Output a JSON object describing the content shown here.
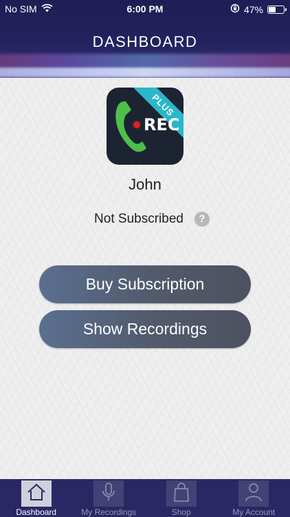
{
  "status_bar": {
    "carrier": "No SIM",
    "time": "6:00 PM",
    "battery": "47%",
    "battery_level": 0.47
  },
  "nav": {
    "title": "DASHBOARD"
  },
  "app_icon": {
    "ribbon": "PLUS",
    "rec_text": "REC"
  },
  "profile": {
    "name": "John",
    "subscription_status": "Not Subscribed",
    "help_symbol": "?"
  },
  "actions": {
    "buy_label": "Buy Subscription",
    "show_label": "Show Recordings"
  },
  "tabs": [
    {
      "label": "Dashboard",
      "icon": "home-icon",
      "active": true
    },
    {
      "label": "My Recordings",
      "icon": "microphone-icon",
      "active": false
    },
    {
      "label": "Shop",
      "icon": "shopping-bag-icon",
      "active": false
    },
    {
      "label": "My Account",
      "icon": "user-icon",
      "active": false
    }
  ],
  "colors": {
    "header": "#24225e",
    "tabbar": "#2a2864",
    "button": "#525a6b",
    "ribbon": "#2ab7c9",
    "handset": "#4cc04a",
    "record": "#e02020"
  }
}
